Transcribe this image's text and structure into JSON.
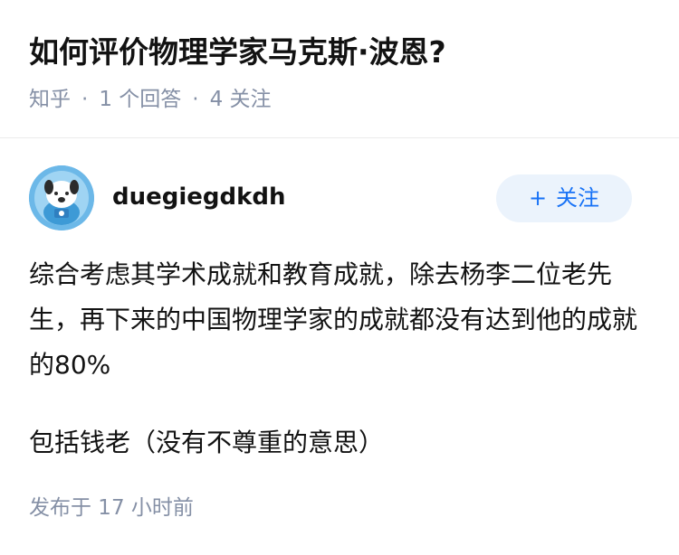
{
  "question": {
    "title": "如何评价物理学家马克斯·波恩?",
    "source": "知乎",
    "answer_count": "1 个回答",
    "follower_count": "4 关注"
  },
  "answer": {
    "author": {
      "name": "duegiegdkdh",
      "avatar_icon": "cartoon-dog-astronaut-avatar"
    },
    "follow_button": {
      "plus_symbol": "+",
      "label": "关注"
    },
    "paragraphs": [
      "综合考虑其学术成就和教育成就，除去杨李二位老先生，再下来的中国物理学家的成就都没有达到他的成就的80%",
      "包括钱老（没有不尊重的意思）"
    ],
    "published": "发布于 17 小时前"
  },
  "colors": {
    "text": "#121212",
    "meta": "#8590a6",
    "accent": "#1772f6",
    "follow_bg": "#ebf3fc",
    "divider": "#ebebeb"
  }
}
